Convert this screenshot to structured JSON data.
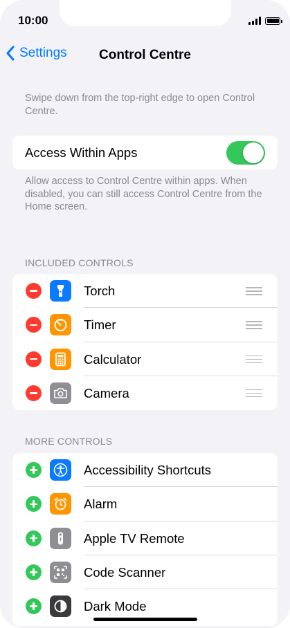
{
  "status_bar": {
    "time": "10:00"
  },
  "nav": {
    "back_label": "Settings",
    "title": "Control Centre"
  },
  "intro_text": "Swipe down from the top-right edge to open Control Centre.",
  "access_within_apps": {
    "label": "Access Within Apps",
    "enabled": true,
    "footer": "Allow access to Control Centre within apps. When disabled, you can still access Control Centre from the Home screen."
  },
  "included": {
    "header": "INCLUDED CONTROLS",
    "items": [
      {
        "label": "Torch",
        "icon": "torch-icon",
        "color": "#0a7aff"
      },
      {
        "label": "Timer",
        "icon": "timer-icon",
        "color": "#ff9500"
      },
      {
        "label": "Calculator",
        "icon": "calculator-icon",
        "color": "#ff9500"
      },
      {
        "label": "Camera",
        "icon": "camera-icon",
        "color": "#8e8e93"
      }
    ]
  },
  "more": {
    "header": "MORE CONTROLS",
    "items": [
      {
        "label": "Accessibility Shortcuts",
        "icon": "accessibility-icon",
        "color": "#0a7aff"
      },
      {
        "label": "Alarm",
        "icon": "alarm-icon",
        "color": "#ff9500"
      },
      {
        "label": "Apple TV Remote",
        "icon": "remote-icon",
        "color": "#8e8e93"
      },
      {
        "label": "Code Scanner",
        "icon": "qr-code-icon",
        "color": "#8e8e93"
      },
      {
        "label": "Dark Mode",
        "icon": "dark-mode-icon",
        "color": "#3a3a3c"
      }
    ]
  },
  "colors": {
    "accent": "#007aff",
    "remove": "#ff3b30",
    "add": "#34c759"
  }
}
